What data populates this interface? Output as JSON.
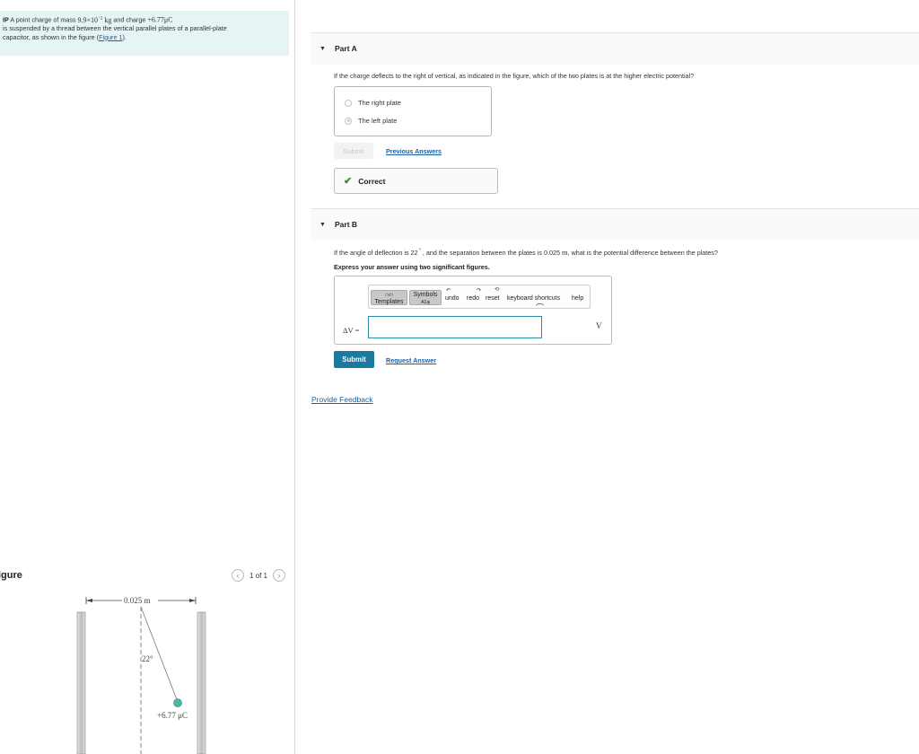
{
  "problem": {
    "prefix": "IP",
    "line1_a": " A point charge of mass ",
    "mass": "9.9×10",
    "mass_exp": "−2",
    "mass_unit": " kg",
    "line1_b": " and charge ",
    "charge": "+6.77μC",
    "line2": "is suspended by a thread between the vertical parallel plates of a parallel-plate",
    "line3": "capacitor, as shown in the figure (",
    "figure_link": "Figure 1",
    "line3_end": ")."
  },
  "figure_panel": {
    "title": "igure",
    "pager": "1 of 1",
    "prev_icon": "‹",
    "next_icon": "›",
    "separation": "0.025 m",
    "angle": "22°",
    "charge_label": "+6.77 μC"
  },
  "partA": {
    "label": "Part A",
    "question": "If the charge deflects to the right of vertical, as indicated in the figure, which of the two plates is at the higher electric potential?",
    "choices": [
      "The right plate",
      "The left plate"
    ],
    "selected_index": 1,
    "submit_label": "Submit",
    "previous_answers": "Previous Answers",
    "result": "Correct",
    "result_icon": "✔"
  },
  "partB": {
    "label": "Part B",
    "question_a": "If the angle of deflection is 22",
    "question_deg": " °",
    "question_b": " , and the separation between the plates is 0.025 ",
    "question_unit": "m",
    "question_c": ", what is the potential difference between the plates?",
    "instruction": "Express your answer using two significant figures.",
    "toolbar": {
      "templates": "Templates",
      "symbols": "Symbols",
      "symbols_sub": "ΑΣφ",
      "undo": "undo",
      "redo": "redo",
      "reset": "reset",
      "shortcuts": "keyboard shortcuts",
      "help": "help"
    },
    "variable": "ΔV =",
    "input_value": "",
    "unit": "V",
    "submit_label": "Submit",
    "request_answer": "Request Answer"
  },
  "feedback_link": "Provide Feedback",
  "colors": {
    "problem_bg": "#e6f4f6",
    "link": "#1a5fa8",
    "submit": "#1a7aa0",
    "correct_check": "#3a8a2e",
    "charge_ball": "#4fb6a4"
  }
}
